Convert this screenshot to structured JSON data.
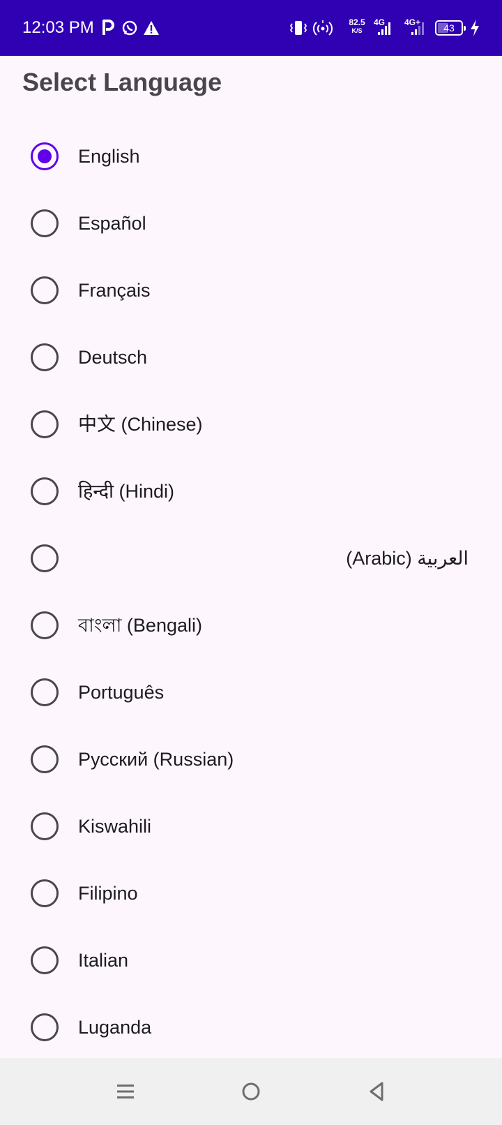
{
  "status_bar": {
    "time": "12:03 PM",
    "speed_value": "82.5",
    "speed_unit": "K/S",
    "network_1": "4G",
    "network_2": "4G+",
    "battery": "43",
    "battery_level": 0.43,
    "icons": [
      "parking-icon",
      "whatsapp-icon",
      "warning-icon",
      "vibrate-icon",
      "hotspot-icon",
      "signal-icon",
      "signal-icon",
      "charging-icon"
    ]
  },
  "page": {
    "title": "Select Language"
  },
  "languages": [
    {
      "label": "English",
      "selected": true
    },
    {
      "label": "Español",
      "selected": false
    },
    {
      "label": "Français",
      "selected": false
    },
    {
      "label": "Deutsch",
      "selected": false
    },
    {
      "label": "中文 (Chinese)",
      "selected": false
    },
    {
      "label": "हिन्दी (Hindi)",
      "selected": false
    },
    {
      "label": "العربية (Arabic)",
      "selected": false,
      "rtl": true
    },
    {
      "label": "বাংলা (Bengali)",
      "selected": false
    },
    {
      "label": "Português",
      "selected": false
    },
    {
      "label": "Русский (Russian)",
      "selected": false
    },
    {
      "label": "Kiswahili",
      "selected": false
    },
    {
      "label": "Filipino",
      "selected": false
    },
    {
      "label": "Italian",
      "selected": false
    },
    {
      "label": "Luganda",
      "selected": false
    }
  ],
  "colors": {
    "status_bar": "#3000b3",
    "accent": "#6200ea",
    "background": "#fdf7fd",
    "nav_bar": "#f0f0f0"
  },
  "nav_bar": {
    "icons": [
      "menu-icon",
      "home-icon",
      "back-icon"
    ]
  }
}
